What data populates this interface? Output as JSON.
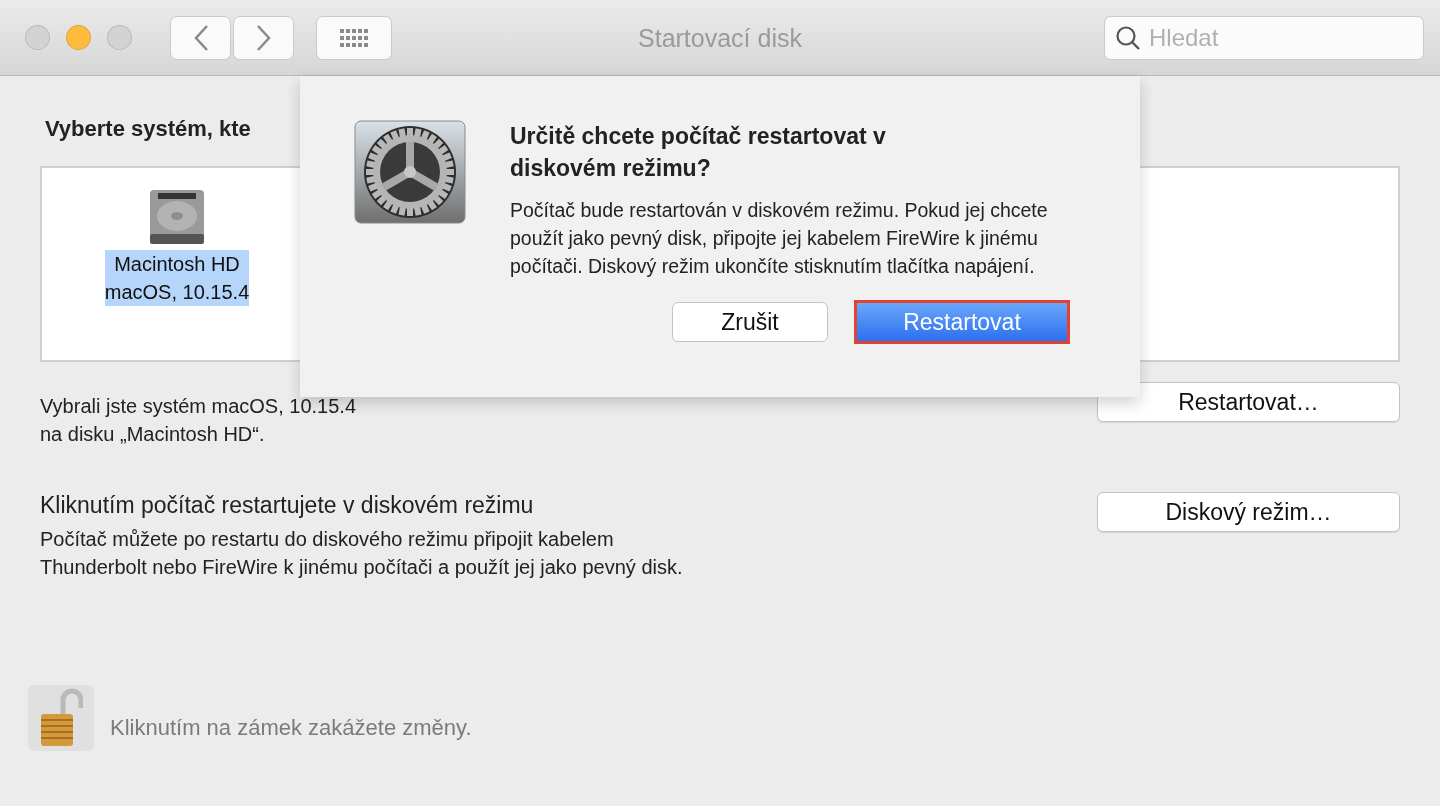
{
  "window": {
    "title": "Startovací disk",
    "traffic_lights": [
      {
        "kind": "close",
        "active": false
      },
      {
        "kind": "minimize",
        "active": true
      },
      {
        "kind": "zoom",
        "active": false
      }
    ]
  },
  "search": {
    "placeholder": "Hledat"
  },
  "heading": "Vyberte systém, kte",
  "disks": [
    {
      "name": "Macintosh HD",
      "system": "macOS, 10.15.4",
      "selected": true
    }
  ],
  "selection_info": "Vybrali jste systém macOS, 10.15.4\nna disku „Macintosh HD“.",
  "restart_button": "Restartovat…",
  "disk_mode": {
    "title": "Kliknutím počítač restartujete v diskovém režimu",
    "description": "Počítač můžete po restartu do diskového režimu připojit kabelem\nThunderbolt nebo FireWire k jinému počítači a použít jej jako pevný disk.",
    "button": "Diskový režim…"
  },
  "lock": {
    "locked": false,
    "text": "Kliknutím na zámek zakážete změny."
  },
  "dialog": {
    "title": "Určitě chcete počítač restartovat v diskovém režimu?",
    "message": "Počítač bude restartován v diskovém režimu. Pokud jej chcete použít jako pevný disk, připojte jej kabelem FireWire k jinému počítači. Diskový režim ukončíte stisknutím tlačítka napájení.",
    "buttons": [
      {
        "label": "Zrušit",
        "kind": "cancel",
        "highlighted": false
      },
      {
        "label": "Restartovat",
        "kind": "default",
        "highlighted": true
      }
    ]
  }
}
